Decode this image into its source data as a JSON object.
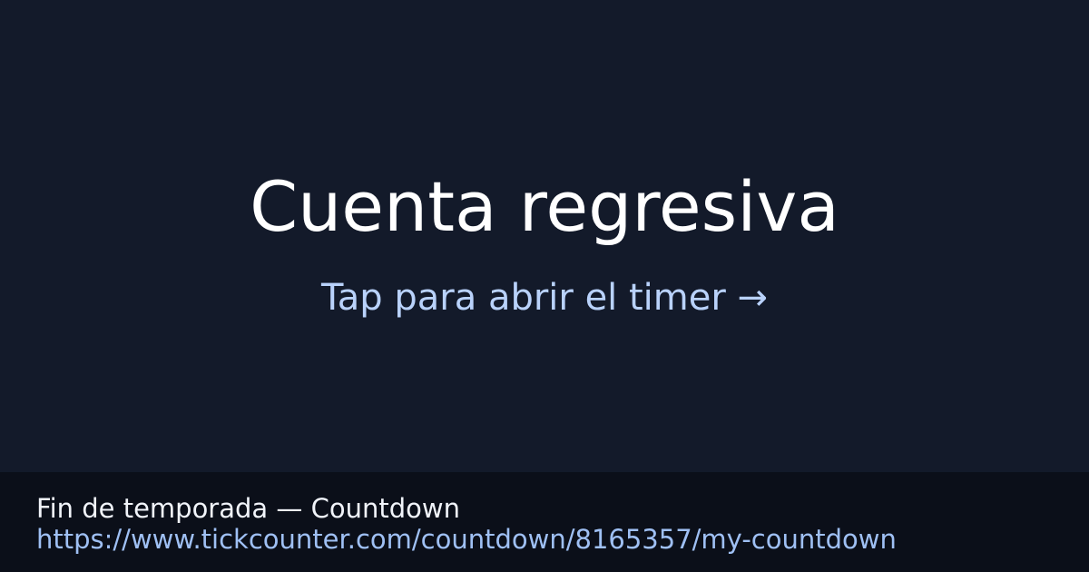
{
  "hero": {
    "title": "Cuenta regresiva",
    "cta_label": "Tap para abrir el timer →"
  },
  "footer": {
    "title": "Fin de temporada — Countdown",
    "url": "https://www.tickcounter.com/countdown/8165357/my-countdown"
  },
  "colors": {
    "background": "#131a2a",
    "footer_background": "#0b0f19",
    "title": "#ffffff",
    "accent": "#b9d2fb",
    "link": "#9fc0f4"
  }
}
